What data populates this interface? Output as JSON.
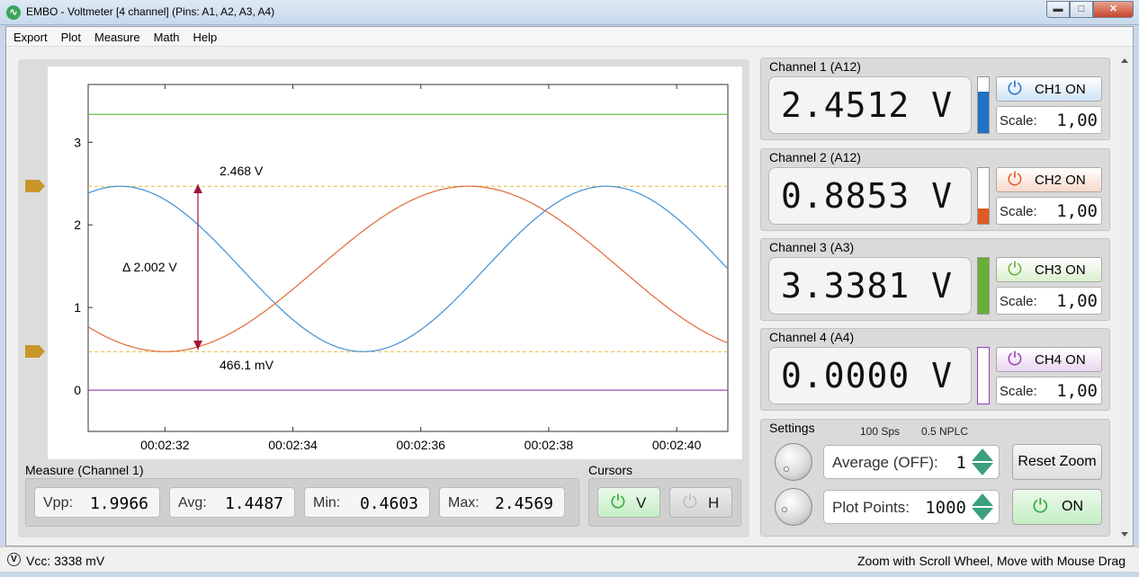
{
  "window": {
    "title": "EMBO - Voltmeter [4 channel] (Pins: A1, A2, A3, A4)",
    "min_glyph": "▬",
    "max_glyph": "□",
    "close_glyph": "✕"
  },
  "menu": [
    "Export",
    "Plot",
    "Measure",
    "Math",
    "Help"
  ],
  "plot": {
    "y_ticks": [
      "0",
      "1",
      "2",
      "3"
    ],
    "x_ticks": [
      "00:02:32",
      "00:02:34",
      "00:02:36",
      "00:02:38",
      "00:02:40"
    ],
    "cursor_top_label": "2.468 V",
    "cursor_bottom_label": "466.1 mV",
    "delta_label": "Δ 2.002 V"
  },
  "chart_data": {
    "type": "line",
    "x_unit": "time",
    "x_ticks": [
      "00:02:32",
      "00:02:34",
      "00:02:36",
      "00:02:38",
      "00:02:40"
    ],
    "ylim": [
      -0.5,
      3.7
    ],
    "y_ticks": [
      0,
      1,
      2,
      3
    ],
    "series": [
      {
        "color": "#3f8fd4",
        "kind": "sine",
        "min": 0.466,
        "max": 2.468,
        "trough_at": "00:02:35.1",
        "period_s": 7.6
      },
      {
        "color": "#e06a35",
        "kind": "sine",
        "min": 0.466,
        "max": 2.468,
        "trough_at": "00:02:32.0",
        "period_s": 9.5
      },
      {
        "color": "#6abf45",
        "kind": "constant",
        "value": 3.338
      },
      {
        "color": "#8e3fb0",
        "kind": "constant",
        "value": 0.0
      }
    ],
    "cursors": {
      "horizontal": [
        2.468,
        0.4661
      ],
      "vertical_time": "00:02:32"
    }
  },
  "measure": {
    "title": "Measure (Channel 1)",
    "items": [
      {
        "label": "Vpp:",
        "value": "1.9966"
      },
      {
        "label": "Avg:",
        "value": "1.4487"
      },
      {
        "label": "Min:",
        "value": "0.4603"
      },
      {
        "label": "Max:",
        "value": "2.4569"
      }
    ]
  },
  "cursors": {
    "title": "Cursors",
    "v_label": "V",
    "h_label": "H"
  },
  "channels": [
    {
      "title": "Channel 1 (A12)",
      "value": "2.4512  V",
      "button": "CH1 ON",
      "scale_label": "Scale:",
      "scale_value": "1,00",
      "color": "#1f72c4",
      "btn_bg": "#cfe4f7",
      "level": 0.74
    },
    {
      "title": "Channel 2  (A12)",
      "value": "0.8853  V",
      "button": "CH2 ON",
      "scale_label": "Scale:",
      "scale_value": "1,00",
      "color": "#e05a22",
      "btn_bg": "#f8d8cb",
      "level": 0.27
    },
    {
      "title": "Channel 3 (A3)",
      "value": "3.3381  V",
      "button": "CH3 ON",
      "scale_label": "Scale:",
      "scale_value": "1,00",
      "color": "#6aae3a",
      "btn_bg": "#daf0cf",
      "level": 1.0
    },
    {
      "title": "Channel 4 (A4)",
      "value": "0.0000  V",
      "button": "CH4 ON",
      "scale_label": "Scale:",
      "scale_value": "1,00",
      "color": "#9b3bb5",
      "btn_bg": "#ead6f1",
      "level": 0.0
    }
  ],
  "settings": {
    "title": "Settings",
    "sps": "100 Sps",
    "nplc": "0.5 NPLC",
    "average_label": "Average (OFF):",
    "average_value": "1",
    "points_label": "Plot Points:",
    "points_value": "1000",
    "reset_zoom": "Reset Zoom",
    "on_label": "ON"
  },
  "status": {
    "vcc": "Vcc: 3338 mV",
    "hint": "Zoom with Scroll Wheel, Move with Mouse Drag"
  },
  "icons": {
    "power": "⏻"
  }
}
